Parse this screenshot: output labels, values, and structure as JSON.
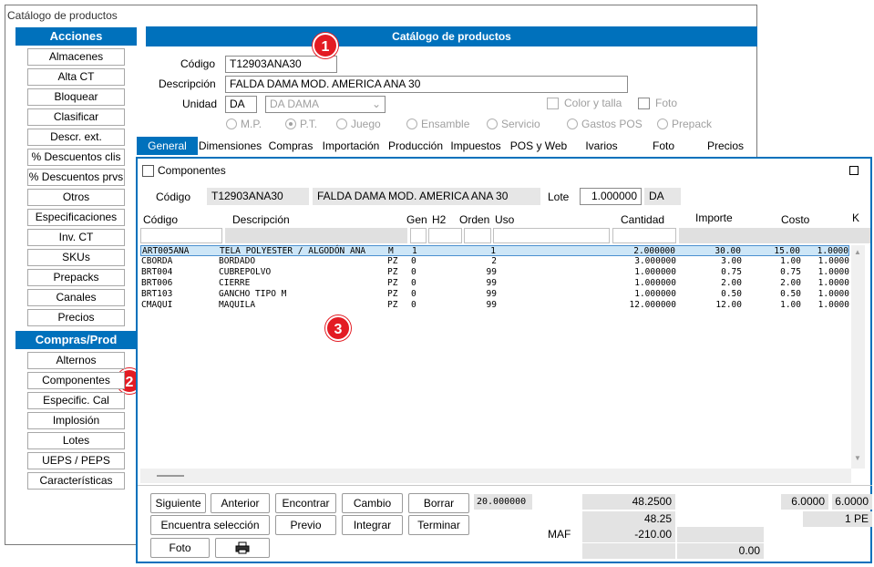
{
  "window": {
    "title": "Catálogo de productos"
  },
  "sidebar": {
    "acciones_header": "Acciones",
    "acciones": [
      "Almacenes",
      "Alta CT",
      "Bloquear",
      "Clasificar",
      "Descr. ext.",
      "% Descuentos clis",
      "% Descuentos prvs",
      "Otros",
      "Especificaciones",
      "Inv. CT",
      "SKUs",
      "Prepacks",
      "Canales",
      "Precios"
    ],
    "compras_header": "Compras/Prod",
    "compras": [
      "Alternos",
      "Componentes",
      "Especific. Cal",
      "Implosión",
      "Lotes",
      "UEPS / PEPS",
      "Características"
    ]
  },
  "product": {
    "header": "Catálogo de productos",
    "codigo_label": "Código",
    "codigo": "T12903ANA30",
    "descripcion_label": "Descripción",
    "descripcion": "FALDA DAMA MOD. AMERICA ANA 30",
    "unidad_label": "Unidad",
    "unidad": "DA",
    "unidad_desc": "DA  DAMA",
    "color_talla": "Color y talla",
    "foto": "Foto",
    "types": [
      "M.P.",
      "P.T.",
      "Juego",
      "Ensamble",
      "Servicio",
      "Gastos POS",
      "Prepack"
    ],
    "selected_type": "P.T."
  },
  "tabs": [
    "General",
    "Dimensiones",
    "Compras",
    "Importación",
    "Producción",
    "Impuestos",
    "POS y Web",
    "Ivarios",
    "Foto",
    "Precios"
  ],
  "active_tab": "General",
  "badges": [
    "1",
    "2",
    "3"
  ],
  "componentes": {
    "title": "Componentes",
    "codigo_label": "Código",
    "codigo": "T12903ANA30",
    "descripcion": "FALDA DAMA MOD. AMERICA ANA 30",
    "lote_label": "Lote",
    "lote": "1.000000",
    "lote_unit": "DA",
    "columns": [
      "Código",
      "Descripción",
      "Gen",
      "H2",
      "Orden",
      "Uso",
      "Cantidad",
      "Importe",
      "Costo",
      "K"
    ],
    "rows": [
      [
        "ART005ANA",
        "TELA POLYESTER / ALGODÓN ANA",
        "M",
        "1",
        "1",
        "2.000000",
        "30.00",
        "15.00",
        "1.0000"
      ],
      [
        "CBORDA",
        "BORDADO",
        "PZ",
        "0",
        "2",
        "3.000000",
        "3.00",
        "1.00",
        "1.0000"
      ],
      [
        "BRT004",
        "CUBREPOLVO",
        "PZ",
        "0",
        "99",
        "1.000000",
        "0.75",
        "0.75",
        "1.0000"
      ],
      [
        "BRT006",
        "CIERRE",
        "PZ",
        "0",
        "99",
        "1.000000",
        "2.00",
        "2.00",
        "1.0000"
      ],
      [
        "BRT103",
        "GANCHO TIPO M",
        "PZ",
        "0",
        "99",
        "1.000000",
        "0.50",
        "0.50",
        "1.0000"
      ],
      [
        "CMAQUI",
        "MAQUILA",
        "PZ",
        "0",
        "99",
        "12.000000",
        "12.00",
        "1.00",
        "1.0000"
      ]
    ],
    "buttons": {
      "siguiente": "Siguiente",
      "anterior": "Anterior",
      "encontrar": "Encontrar",
      "cambio": "Cambio",
      "borrar": "Borrar",
      "encuentra_seleccion": "Encuentra selección",
      "previo": "Previo",
      "integrar": "Integrar",
      "terminar": "Terminar",
      "foto": "Foto",
      "print_icon": "printer-icon"
    },
    "totals": {
      "cantidad_total": "20.000000",
      "importe_total": "48.2500",
      "importe_redondeado": "48.25",
      "maf_label": "MAF",
      "maf": "-210.00",
      "saldo": "0.00",
      "costo_total": "6.0000",
      "k_total": "6.0000",
      "unidad_pe": "1 PE"
    }
  },
  "colors": {
    "accent": "#0071bc",
    "badge": "#e31b23",
    "selected_row": "#cde6f7"
  }
}
